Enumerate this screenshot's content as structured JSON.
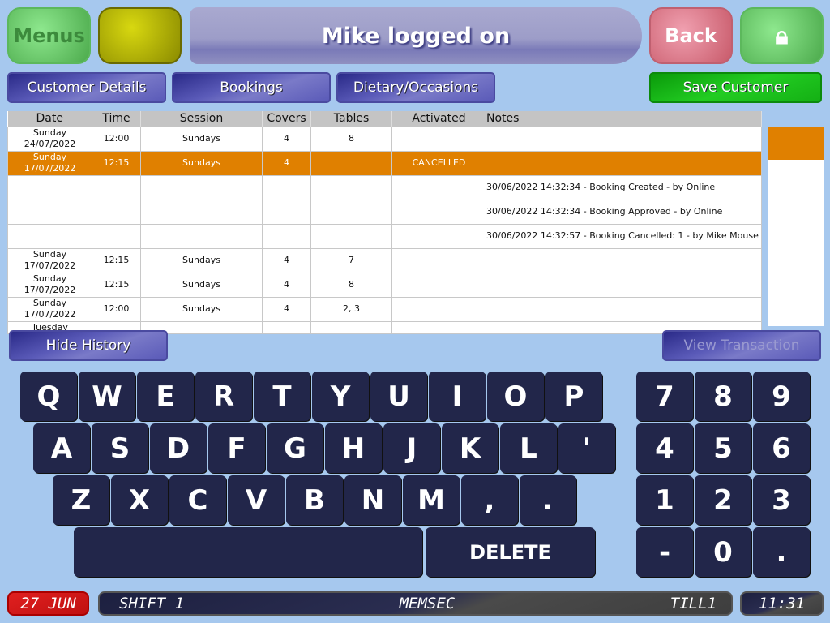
{
  "header": {
    "menus": "Menus",
    "title": "Mike logged on",
    "back": "Back"
  },
  "tabs": [
    {
      "label": "Customer Details"
    },
    {
      "label": "Bookings"
    },
    {
      "label": "Dietary/Occasions"
    }
  ],
  "save_customer": "Save Customer",
  "table": {
    "columns": [
      "Date",
      "Time",
      "Session",
      "Covers",
      "Tables",
      "Activated",
      "Notes"
    ],
    "rows": [
      {
        "date": "Sunday 24/07/2022",
        "time": "12:00",
        "session": "Sundays",
        "covers": "4",
        "tables": "8",
        "activated": "",
        "notes": ""
      },
      {
        "date": "Sunday 17/07/2022",
        "time": "12:15",
        "session": "Sundays",
        "covers": "4",
        "tables": "",
        "activated": "CANCELLED",
        "notes": "",
        "selected": true
      },
      {
        "date": "",
        "time": "",
        "session": "",
        "covers": "",
        "tables": "",
        "activated": "",
        "notes": "30/06/2022 14:32:34 - Booking Created - by Online"
      },
      {
        "date": "",
        "time": "",
        "session": "",
        "covers": "",
        "tables": "",
        "activated": "",
        "notes": "30/06/2022 14:32:34 - Booking Approved - by Online"
      },
      {
        "date": "",
        "time": "",
        "session": "",
        "covers": "",
        "tables": "",
        "activated": "",
        "notes": "30/06/2022 14:32:57 - Booking Cancelled: 1 - by Mike Mouse"
      },
      {
        "date": "Sunday 17/07/2022",
        "time": "12:15",
        "session": "Sundays",
        "covers": "4",
        "tables": "7",
        "activated": "",
        "notes": ""
      },
      {
        "date": "Sunday 17/07/2022",
        "time": "12:15",
        "session": "Sundays",
        "covers": "4",
        "tables": "8",
        "activated": "",
        "notes": ""
      },
      {
        "date": "Sunday 17/07/2022",
        "time": "12:00",
        "session": "Sundays",
        "covers": "4",
        "tables": "2, 3",
        "activated": "",
        "notes": ""
      },
      {
        "date": "Tuesday",
        "time": "",
        "session": "",
        "covers": "",
        "tables": "",
        "activated": "",
        "notes": ""
      }
    ]
  },
  "hide_history": "Hide History",
  "view_transaction": "View Transaction",
  "keyboard": {
    "rows": [
      [
        "Q",
        "W",
        "E",
        "R",
        "T",
        "Y",
        "U",
        "I",
        "O",
        "P"
      ],
      [
        "A",
        "S",
        "D",
        "F",
        "G",
        "H",
        "J",
        "K",
        "L",
        "'"
      ],
      [
        "Z",
        "X",
        "C",
        "V",
        "B",
        "N",
        "M",
        ",",
        "."
      ]
    ],
    "delete": "DELETE",
    "numpad": [
      [
        "7",
        "8",
        "9"
      ],
      [
        "4",
        "5",
        "6"
      ],
      [
        "1",
        "2",
        "3"
      ],
      [
        "-",
        "0",
        "."
      ]
    ]
  },
  "status": {
    "date": "27 JUN",
    "shift": "SHIFT 1",
    "site": "MEMSEC",
    "till": "TILL1",
    "time": "11:31"
  },
  "colors": {
    "selected_row": "#e08000",
    "save": "#12b812",
    "back": "#d87080",
    "menus": "#6fd06f",
    "key": "#22264a"
  }
}
